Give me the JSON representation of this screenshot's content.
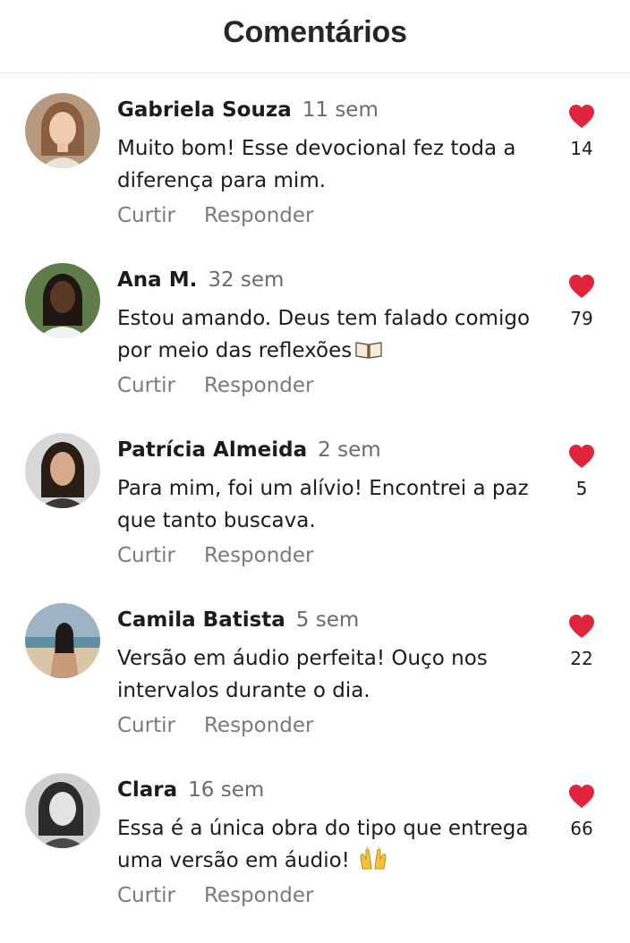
{
  "header": {
    "title": "Comentários"
  },
  "comments": [
    {
      "author": "Gabriela Souza",
      "time": "11 sem",
      "text": "Muito bom! Esse devocional fez toda a diferença para mim.",
      "likes": "14",
      "like_label": "Curtir",
      "reply_label": "Responder",
      "emoji": ""
    },
    {
      "author": "Ana M.",
      "time": "32 sem",
      "text": "Estou amando. Deus tem falado comigo por meio das reflexões",
      "likes": "79",
      "like_label": "Curtir",
      "reply_label": "Responder",
      "emoji": "open-book-icon"
    },
    {
      "author": "Patrícia Almeida",
      "time": "2 sem",
      "text": "Para mim, foi um alívio! Encontrei a paz que tanto buscava.",
      "likes": "5",
      "like_label": "Curtir",
      "reply_label": "Responder",
      "emoji": ""
    },
    {
      "author": "Camila Batista",
      "time": "5 sem",
      "text": "Versão em áudio perfeita! Ouço nos intervalos durante o dia.",
      "likes": "22",
      "like_label": "Curtir",
      "reply_label": "Responder",
      "emoji": ""
    },
    {
      "author": "Clara",
      "time": "16 sem",
      "text": "Essa é a única obra do tipo que entrega uma versão em áudio!",
      "likes": "66",
      "like_label": "Curtir",
      "reply_label": "Responder",
      "emoji": "raising-hands-icon"
    }
  ],
  "colors": {
    "heart": "#e0243c",
    "muted": "#6b6b6b",
    "text": "#1c1c1e"
  }
}
